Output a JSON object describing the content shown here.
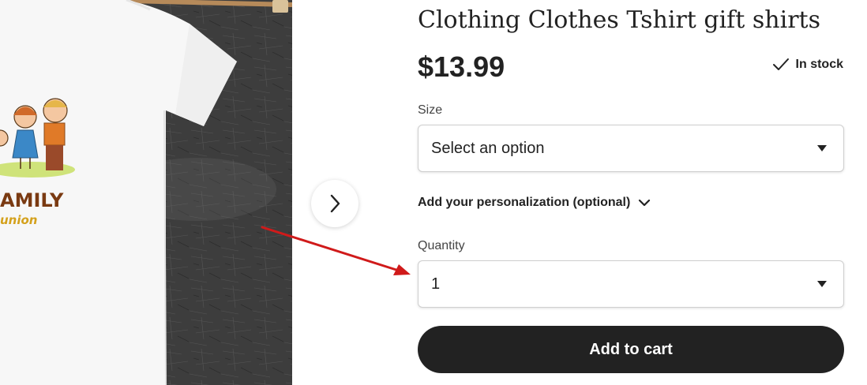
{
  "product": {
    "title": "Clothing Clothes Tshirt gift shirts",
    "price": "$13.99",
    "stock_status": "In stock",
    "print_text": "AMILY",
    "print_subtext": "union"
  },
  "size": {
    "label": "Size",
    "selected": "Select an option"
  },
  "personalization": {
    "label": "Add your personalization (optional)"
  },
  "quantity": {
    "label": "Quantity",
    "selected": "1"
  },
  "actions": {
    "add_to_cart": "Add to cart"
  },
  "icons": {
    "next": "chevron-right-icon",
    "stock": "check-icon",
    "expand": "chevron-down-icon",
    "dropdown": "caret-down-icon"
  },
  "colors": {
    "button_bg": "#222222",
    "annotation_arrow": "#d01a1a"
  }
}
